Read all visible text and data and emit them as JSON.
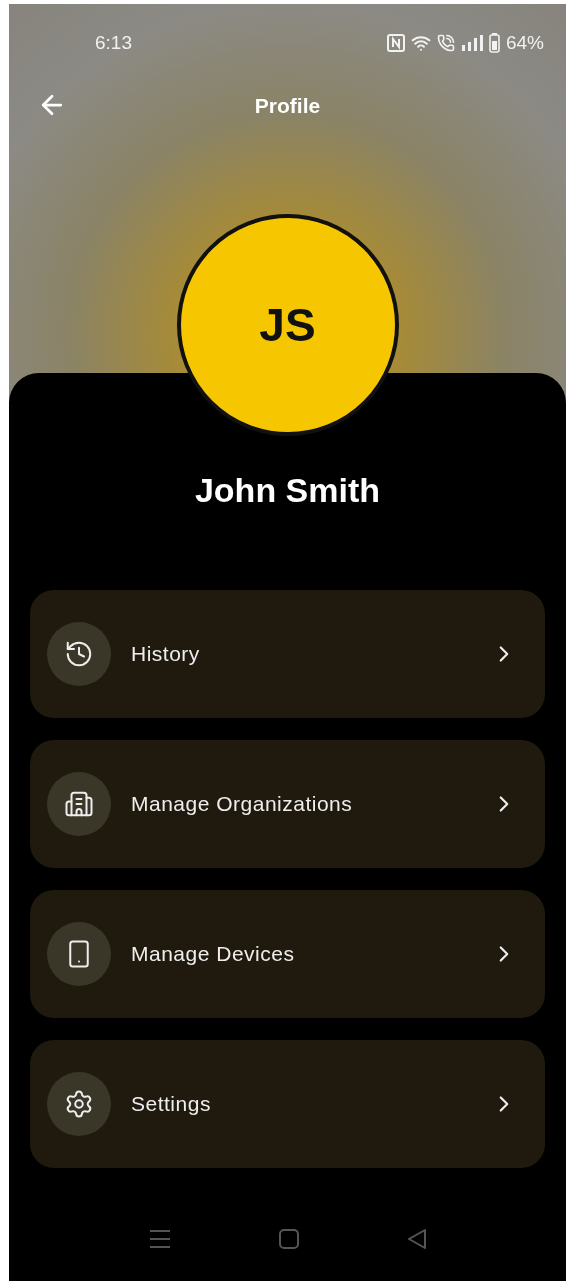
{
  "status_bar": {
    "time": "6:13",
    "battery": "64%"
  },
  "header": {
    "title": "Profile"
  },
  "profile": {
    "initials": "JS",
    "name": "John Smith"
  },
  "menu": [
    {
      "label": "History"
    },
    {
      "label": "Manage Organizations"
    },
    {
      "label": "Manage Devices"
    },
    {
      "label": "Settings"
    }
  ]
}
